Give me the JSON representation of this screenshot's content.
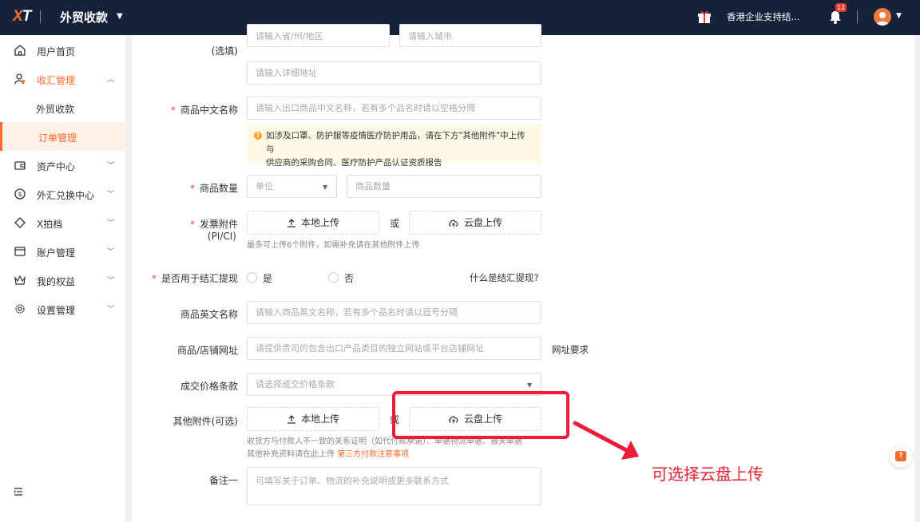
{
  "topbar": {
    "logo_x": "X",
    "logo_t": "T",
    "app_title": "外贸收款",
    "promo_text": "香港企业支持结...",
    "notification_count": "12"
  },
  "sidebar": {
    "items": [
      {
        "label": "用户首页",
        "icon": "home-icon"
      },
      {
        "label": "收汇管理",
        "icon": "user-pin-icon"
      },
      {
        "label": "外贸收款"
      },
      {
        "label": "订单管理"
      },
      {
        "label": "资产中心",
        "icon": "wallet-icon"
      },
      {
        "label": "外汇兑换中心",
        "icon": "exchange-icon"
      },
      {
        "label": "X拍档",
        "icon": "diamond-icon"
      },
      {
        "label": "账户管理",
        "icon": "account-card-icon"
      },
      {
        "label": "我的权益",
        "icon": "crown-icon"
      },
      {
        "label": "设置管理",
        "icon": "gear-icon"
      }
    ]
  },
  "form": {
    "address": {
      "label_optional": "(选填)",
      "region_placeholder": "请输入省/州/地区",
      "city_placeholder": "请输入城市",
      "detail_placeholder": "请输入详细地址"
    },
    "product_cn": {
      "label": "商品中文名称",
      "placeholder": "请输入出口商品中文名称，若有多个品名时请以空格分隔"
    },
    "notice": {
      "line1": "如涉及口罩、防护服等疫情医疗防护用品，请在下方\"其他附件\"中上传与",
      "line2": "供应商的采购合同、医疗防护产品认证资质报告"
    },
    "quantity": {
      "label": "商品数量",
      "unit_placeholder": "单位",
      "qty_placeholder": "商品数量"
    },
    "invoice": {
      "label_line1": "发票附件",
      "label_line2": "(PI/CI)",
      "local_upload": "本地上传",
      "or": "或",
      "cloud_upload": "云盘上传",
      "hint": "最多可上传6个附件，如需补充请在其他附件上传"
    },
    "settlement": {
      "label": "是否用于结汇提现",
      "yes": "是",
      "no": "否",
      "help_link": "什么是结汇提现?"
    },
    "product_en": {
      "label": "商品英文名称",
      "placeholder": "请输入商品英文名称，若有多个品名时请以逗号分隔"
    },
    "shop_url": {
      "label": "商品/店铺网址",
      "placeholder": "请提供贵司的包含出口产品类目的独立网站或平台店铺网址",
      "link": "网址要求"
    },
    "price_terms": {
      "label": "成交价格条款",
      "placeholder": "请选择成交价格条款"
    },
    "other_attach": {
      "label": "其他附件(可选)",
      "local_upload": "本地上传",
      "or": "或",
      "cloud_upload": "云盘上传",
      "hint_line1": "收货方与付款人不一致的关系证明（如代付款承诺）、单据物流单据、报关单据",
      "hint_line2": "其他补充资料请在此上传",
      "hint_link": "第三方付款注意事项"
    },
    "remark": {
      "label": "备注一",
      "placeholder": "可填写关于订单、物流的补充说明或更多联系方式"
    }
  },
  "annotation": {
    "text": "可选择云盘上传",
    "color": "#e8202f"
  },
  "colors": {
    "topbar": "#16223a",
    "accent": "#ff6a2a",
    "required": "#e8453c"
  }
}
